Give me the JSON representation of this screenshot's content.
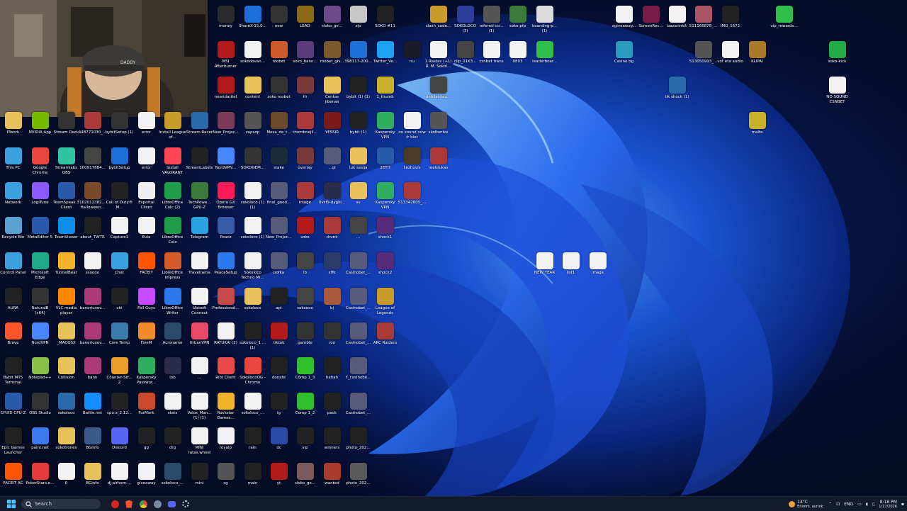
{
  "webcam": {
    "cap_text": "DADDY"
  },
  "desktop_icons": [
    {
      "label": "money",
      "color": "#2b2b2b"
    },
    {
      "label": "ShareX-15.0...",
      "color": "#1e6fd9"
    },
    {
      "label": "new",
      "color": "#333"
    },
    {
      "label": "LEAD",
      "color": "#8a6a1a"
    },
    {
      "label": "sloko_ge...",
      "color": "#6a4a8a"
    },
    {
      "label": "zip",
      "color": "#c7c7c7"
    },
    {
      "label": "SOKO #11",
      "color": "#222"
    },
    {
      "label": "clash_code...",
      "color": "#c89b2b"
    },
    {
      "label": "SOKOLOCO (3)",
      "color": "#2c3e9a"
    },
    {
      "label": "referral-co... (1)",
      "color": "#555"
    },
    {
      "label": "soko-pfp",
      "color": "#3a7a3a"
    },
    {
      "label": "boarding-p... (1)",
      "color": "#ddd"
    },
    {
      "label": "xgiveaway...",
      "color": "#f2f2f2"
    },
    {
      "label": "ScreenRec...",
      "color": "#7a1a4a"
    },
    {
      "label": "bazarinkit",
      "color": "#f2f2f2"
    },
    {
      "label": "511166878_...",
      "color": "#aa5566"
    },
    {
      "label": "IMG_1672",
      "color": "#222"
    },
    {
      "label": "vip_rewards...",
      "color": "#2fbf4a"
    },
    {
      "label": "MSI Afterburner",
      "color": "#b31b1b"
    },
    {
      "label": "sokodovan...",
      "color": "#f2f2f2"
    },
    {
      "label": "roobet",
      "color": "#cc5a2a"
    },
    {
      "label": "soko_bann...",
      "color": "#5a3a7a"
    },
    {
      "label": "roobet_giv...",
      "color": "#7a5a2a"
    },
    {
      "label": "398117-200...",
      "color": "#1d6fd6"
    },
    {
      "label": "Twitter_Ve...",
      "color": "#1da1f2"
    },
    {
      "label": "nu",
      "color": "#1a1a2a"
    },
    {
      "label": "1 Rastas (+1) R. M. Sokol...",
      "color": "#f2f2f2"
    },
    {
      "label": "clip_01K3...",
      "color": "#444"
    },
    {
      "label": "csnbet trans",
      "color": "#f2f2f2"
    },
    {
      "label": "0803",
      "color": "#f2f2f2"
    },
    {
      "label": "leaderboar...",
      "color": "#2fbf4a"
    },
    {
      "label": "Casino bg",
      "color": "#2a9abf"
    },
    {
      "label": "513050993_...",
      "color": "#555"
    },
    {
      "label": "vot eta audio",
      "color": "#f2f2f2"
    },
    {
      "label": "KLIPAI",
      "color": "#aa7a2a"
    },
    {
      "label": "soko-kick",
      "color": "#22aa44"
    },
    {
      "label": "neandartiel",
      "color": "#b31b1b"
    },
    {
      "label": "content",
      "color": "#e8c15a"
    },
    {
      "label": "soko roobet",
      "color": "#333"
    },
    {
      "label": "th",
      "color": "#7a3a3a"
    },
    {
      "label": "Centas jibenas",
      "color": "#e8c15a"
    },
    {
      "label": "bybit (1) (1)",
      "color": "#222"
    },
    {
      "label": "1_thumb",
      "color": "#c8b02a"
    },
    {
      "label": "debilasdau...",
      "color": "#444"
    },
    {
      "label": "tik shock (1)",
      "color": "#2a6aaa"
    },
    {
      "label": "NO SOUND CSNBET",
      "color": "#f2f2f2"
    },
    {
      "label": "ITwork",
      "color": "#e8c15a"
    },
    {
      "label": "NVIDIA App",
      "color": "#76b900"
    },
    {
      "label": "Stream Deck",
      "color": "#333"
    },
    {
      "label": "448771030_...",
      "color": "#aa3a3a"
    },
    {
      "label": "bybitSetup (1)",
      "color": "#333"
    },
    {
      "label": "error",
      "color": "#f2f2f2"
    },
    {
      "label": "Install League of...",
      "color": "#c89b2b"
    },
    {
      "label": "Stream Racer",
      "color": "#2a6aaa"
    },
    {
      "label": "New_Projec...",
      "color": "#7a3a5a"
    },
    {
      "label": "zapsop",
      "color": "#555"
    },
    {
      "label": "Mesa_de_t...",
      "color": "#6a4a2a"
    },
    {
      "label": "thumbnejli...",
      "color": "#aa3a3a"
    },
    {
      "label": "YESSIR",
      "color": "#7a1a1a"
    },
    {
      "label": "bybit (1)",
      "color": "#222"
    },
    {
      "label": "Kaspersky VPN",
      "color": "#2fae5f"
    },
    {
      "label": "no sound now fr blet",
      "color": "#f2f2f2"
    },
    {
      "label": "skolberike",
      "color": "#555"
    },
    {
      "label": "malta",
      "color": "#c8b02a"
    },
    {
      "label": "This PC",
      "color": "#3aa0e0"
    },
    {
      "label": "Google Chrome",
      "color": "#e8453c"
    },
    {
      "label": "Streamlabs OBS",
      "color": "#31c3a2"
    },
    {
      "label": "100917884...",
      "color": "#444"
    },
    {
      "label": "bybitSetup",
      "color": "#1d6fd6"
    },
    {
      "label": "error",
      "color": "#f2f2f2"
    },
    {
      "label": "Install VALORANT",
      "color": "#ff4655"
    },
    {
      "label": "StreamLabels",
      "color": "#222"
    },
    {
      "label": "NordVPN...",
      "color": "#4687ff"
    },
    {
      "label": "SOKOGEM...",
      "color": "#333"
    },
    {
      "label": "stake",
      "color": "#1a2c38"
    },
    {
      "label": "overlay",
      "color": "#7a3a3a"
    },
    {
      "label": "...gl",
      "color": "#5a5a7a"
    },
    {
      "label": "tuk sesija",
      "color": "#e8c15a"
    },
    {
      "label": "2ETH",
      "color": "#2a5aaa"
    },
    {
      "label": "liezhuvis",
      "color": "#4a3a2a"
    },
    {
      "label": "reelsiukas",
      "color": "#aa3a3a"
    },
    {
      "label": "Network",
      "color": "#3aa0e0"
    },
    {
      "label": "LogiTune",
      "color": "#8a5aff"
    },
    {
      "label": "TeamSpeak 3 Client",
      "color": "#2a5aaa"
    },
    {
      "label": "102012382... Halloween...",
      "color": "#7a4a2a"
    },
    {
      "label": "Call of Duty® M...",
      "color": "#222"
    },
    {
      "label": "Esportal Client",
      "color": "#eee"
    },
    {
      "label": "LibreOffice Calc (2)",
      "color": "#1e9e4a"
    },
    {
      "label": "TechPowe... GPU-Z",
      "color": "#3a7a3a"
    },
    {
      "label": "Opera GX Browser",
      "color": "#ff1b5a"
    },
    {
      "label": "sokoloco (1) (1)",
      "color": "#f2f2f2"
    },
    {
      "label": "final_good...",
      "color": "#5a5a7a"
    },
    {
      "label": "image",
      "color": "#aa3a3a"
    },
    {
      "label": "0vsf9-dyglo...",
      "color": "#2a2a4a"
    },
    {
      "label": "su",
      "color": "#e8c15a"
    },
    {
      "label": "Kaspersky VPN",
      "color": "#2fae5f"
    },
    {
      "label": "513342605_...",
      "color": "#aa3a3a"
    },
    {
      "label": "Recycle Bin",
      "color": "#5aa0d0"
    },
    {
      "label": "MetaEditor 5",
      "color": "#2a5aaa"
    },
    {
      "label": "TeamViewer",
      "color": "#0e8ee9"
    },
    {
      "label": "about_TWTR",
      "color": "#222"
    },
    {
      "label": "Capture1",
      "color": "#f2f2f2"
    },
    {
      "label": "Eula",
      "color": "#f2f2f2"
    },
    {
      "label": "LibreOffice Calc",
      "color": "#1e9e4a"
    },
    {
      "label": "Telegram",
      "color": "#2aa3e0"
    },
    {
      "label": "Peace",
      "color": "#3a5aaa"
    },
    {
      "label": "sokoloco (1)",
      "color": "#f2f2f2"
    },
    {
      "label": "New_Projec...",
      "color": "#5a5a7a"
    },
    {
      "label": "soko",
      "color": "#b31b1b"
    },
    {
      "label": "drunk",
      "color": "#aa3a3a"
    },
    {
      "label": "...",
      "color": "#444"
    },
    {
      "label": "shock1",
      "color": "#5a2a7a"
    },
    {
      "label": "Control Panel",
      "color": "#3aa0e0"
    },
    {
      "label": "Microsoft Edge",
      "color": "#1eaa8a"
    },
    {
      "label": "TunnelBear",
      "color": "#f2b32a"
    },
    {
      "label": "ssoooo",
      "color": "#f2f2f2"
    },
    {
      "label": "Chat",
      "color": "#3aa0e0"
    },
    {
      "label": "FACEIT",
      "color": "#ff5500"
    },
    {
      "label": "LibreOffice Impress",
      "color": "#d35a2a"
    },
    {
      "label": "Travelrama",
      "color": "#f2f2f2"
    },
    {
      "label": "PeaceSetup",
      "color": "#2a7aee"
    },
    {
      "label": "Sokoloco Techno Mi...",
      "color": "#f2f2f2"
    },
    {
      "label": "pofka",
      "color": "#5a5a7a"
    },
    {
      "label": "lb",
      "color": "#444"
    },
    {
      "label": "sffk",
      "color": "#2a3a6a"
    },
    {
      "label": "Casinobet_...",
      "color": "#5a5a7a"
    },
    {
      "label": "shock2",
      "color": "#5a2a7a"
    },
    {
      "label": "NEW YEAR",
      "color": "#f2f2f2"
    },
    {
      "label": "list1",
      "color": "#f2f2f2"
    },
    {
      "label": "image",
      "color": "#f2f2f2"
    },
    {
      "label": "AURA",
      "color": "#222"
    },
    {
      "label": "NaturalB (x64)",
      "color": "#333"
    },
    {
      "label": "VLC media player",
      "color": "#ff8800"
    },
    {
      "label": "baneriuxov...",
      "color": "#aa3a7a"
    },
    {
      "label": "chi",
      "color": "#222"
    },
    {
      "label": "Fall Guys",
      "color": "#c84aff"
    },
    {
      "label": "LibreOffice Writer",
      "color": "#2a7aee"
    },
    {
      "label": "Ubisoft Connect",
      "color": "#f2f2f2"
    },
    {
      "label": "Professional...",
      "color": "#c84a4a"
    },
    {
      "label": "sokoloco",
      "color": "#e8c15a"
    },
    {
      "label": "api",
      "color": "#222"
    },
    {
      "label": "sokoooo",
      "color": "#444"
    },
    {
      "label": "bj",
      "color": "#aa5a3a"
    },
    {
      "label": "Casinobet_...",
      "color": "#5a5a7a"
    },
    {
      "label": "League of Legends",
      "color": "#c89b2b"
    },
    {
      "label": "Brave",
      "color": "#fb542b"
    },
    {
      "label": "NordVPN",
      "color": "#4687ff"
    },
    {
      "label": "_MACOSX",
      "color": "#e8c15a"
    },
    {
      "label": "baneriuxov...",
      "color": "#aa3a7a"
    },
    {
      "label": "Core Temp",
      "color": "#3a7aaa"
    },
    {
      "label": "FiveM",
      "color": "#f28a2a"
    },
    {
      "label": "Acroname",
      "color": "#2a4a6a"
    },
    {
      "label": "UrbanVPN",
      "color": "#e84a6a"
    },
    {
      "label": "RATUKAI (2)",
      "color": "#f2f2f2"
    },
    {
      "label": "sokoloco_1 ... (1)",
      "color": "#222"
    },
    {
      "label": "tiktok",
      "color": "#b31b1b"
    },
    {
      "label": "gamble",
      "color": "#333"
    },
    {
      "label": "roo",
      "color": "#333"
    },
    {
      "label": "Casinobet_...",
      "color": "#5a5a7a"
    },
    {
      "label": "ARC Raiders",
      "color": "#aa3a3a"
    },
    {
      "label": "Bybit MT5 Terminal",
      "color": "#222"
    },
    {
      "label": "Notepad++",
      "color": "#8ac04a"
    },
    {
      "label": "Collision",
      "color": "#e8c15a"
    },
    {
      "label": "bann",
      "color": "#aa3a7a"
    },
    {
      "label": "Counter-Str... 2",
      "color": "#e8a02a"
    },
    {
      "label": "Kaspersky Passwor...",
      "color": "#2fae5f"
    },
    {
      "label": "lob",
      "color": "#2a2a4a"
    },
    {
      "label": "...",
      "color": "#f2f2f2"
    },
    {
      "label": "Riot Client",
      "color": "#e84a4a"
    },
    {
      "label": "SokolocoOG - Chrome",
      "color": "#e8453c"
    },
    {
      "label": "donate",
      "color": "#222"
    },
    {
      "label": "Comp 1_3",
      "color": "#2fbf2a"
    },
    {
      "label": "hahah",
      "color": "#222"
    },
    {
      "label": "Y_casinobe...",
      "color": "#5a5a7a"
    },
    {
      "label": "CPUID CPU-Z",
      "color": "#2a5aaa"
    },
    {
      "label": "OBS Studio",
      "color": "#333"
    },
    {
      "label": "sokoloco",
      "color": "#2a6aaa"
    },
    {
      "label": "Battle.net",
      "color": "#148eff"
    },
    {
      "label": "cpu-z_2.12...",
      "color": "#222"
    },
    {
      "label": "FurMark",
      "color": "#c84a2a"
    },
    {
      "label": "stats",
      "color": "#f2f2f2"
    },
    {
      "label": "Volos_Man... (1) (1)",
      "color": "#f2f2f2"
    },
    {
      "label": "Rockstar Games...",
      "color": "#f2b32a"
    },
    {
      "label": "sokoloco_...",
      "color": "#f2f2f2"
    },
    {
      "label": "ig",
      "color": "#222"
    },
    {
      "label": "Comp 1_2",
      "color": "#2fbf2a"
    },
    {
      "label": "pack",
      "color": "#222"
    },
    {
      "label": "Casinobet_...",
      "color": "#5a5a7a"
    },
    {
      "label": "Epic Games Launcher",
      "color": "#222"
    },
    {
      "label": "paint.net",
      "color": "#3a7aee"
    },
    {
      "label": "sokotrones",
      "color": "#e8c15a"
    },
    {
      "label": "BGinfo",
      "color": "#3a5a8a"
    },
    {
      "label": "Discord",
      "color": "#5865f2"
    },
    {
      "label": "gg",
      "color": "#222"
    },
    {
      "label": "drg",
      "color": "#222"
    },
    {
      "label": "MINI ratas.wheel",
      "color": "#f2f2f2"
    },
    {
      "label": "royalp",
      "color": "#f2f2f2"
    },
    {
      "label": "rain",
      "color": "#222"
    },
    {
      "label": "dc",
      "color": "#2a4aaa"
    },
    {
      "label": "vip",
      "color": "#222"
    },
    {
      "label": "winners",
      "color": "#222"
    },
    {
      "label": "photo_202...",
      "color": "#222"
    },
    {
      "label": "FACEIT AC",
      "color": "#ff5500"
    },
    {
      "label": "PokerStars.e...",
      "color": "#e83a3a"
    },
    {
      "label": "0",
      "color": "#f2f2f2"
    },
    {
      "label": "BGinfo",
      "color": "#e8c15a"
    },
    {
      "label": "dj-airhom-...",
      "color": "#f2f2f2"
    },
    {
      "label": "giveaway",
      "color": "#f2f2f2"
    },
    {
      "label": "sokoloco_...",
      "color": "#2a4a6a"
    },
    {
      "label": "mini",
      "color": "#222"
    },
    {
      "label": "sg",
      "color": "#555"
    },
    {
      "label": "main",
      "color": "#222"
    },
    {
      "label": "yt",
      "color": "#b31b1b"
    },
    {
      "label": "sloko_ge...",
      "color": "#7a5a5a"
    },
    {
      "label": "wanted",
      "color": "#aa3a2a"
    },
    {
      "label": "photo_202...",
      "color": "#5a5a5a"
    }
  ],
  "taskbar": {
    "search_placeholder": "Search",
    "weather_temp": "14°C",
    "weather_desc": "Enimm. aurink.",
    "language": "ENG",
    "time": "8:18 PM",
    "date": "1/17/2026"
  }
}
